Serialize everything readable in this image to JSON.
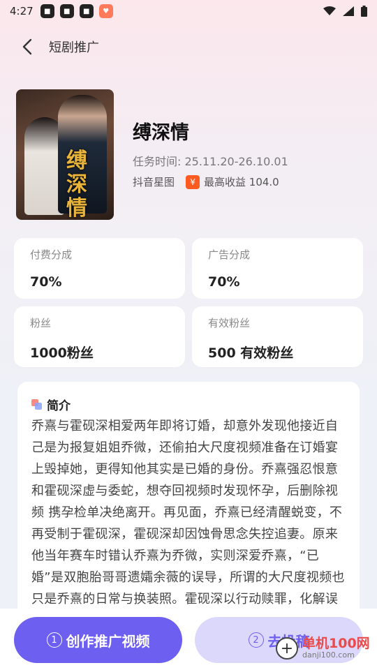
{
  "status_bar": {
    "time": "4:27",
    "app_icons": [
      "app-notification-icon",
      "app-notification-icon",
      "app-notification-icon",
      "app-notification-icon"
    ],
    "system_icons": [
      "wifi-icon",
      "signal-icon",
      "battery-icon"
    ]
  },
  "nav": {
    "title": "短剧推广"
  },
  "drama": {
    "cover_title": "缚深情",
    "title": "缚深情",
    "task_time": "任务时间: 25.11.20-26.10.01",
    "platform": "抖音星图",
    "max_income": "最高收益 104.0",
    "currency_symbol": "¥"
  },
  "stats": [
    {
      "label": "付费分成",
      "value": "70%"
    },
    {
      "label": "广告分成",
      "value": "70%"
    },
    {
      "label": "粉丝",
      "value": "1000粉丝"
    },
    {
      "label": "有效粉丝",
      "value": "500 有效粉丝"
    }
  ],
  "intro": {
    "title": "简介",
    "text": "乔熹与霍砚深相爱两年即将订婚，却意外发现他接近自己是为报复姐姐乔微，还偷拍大尺度视频准备在订婚宴上毁掉她，更得知他其实是已婚的身份。乔熹强忍恨意和霍砚深虚与委蛇，想夺回视频时发现怀孕，后删除视频 携孕检单决绝离开。再见面，乔熹已经清醒蜕变，不再受制于霍砚深，霍砚深却因蚀骨思念失控追妻。原来他当年赛车时错认乔熹为乔微，实则深爱乔熹，“已婚”是双胞胎哥哥遗孀余薇的误导，所谓的大尺度视频也只是乔熹的日常与换装照。霍砚深以行动赎罪，化解误"
  },
  "actions": {
    "create": {
      "num": "1",
      "label": "创作推广视频"
    },
    "submit": {
      "num": "2",
      "label": "去投稿"
    }
  },
  "watermark": {
    "main": "单机100网",
    "sub": "danji100.com"
  },
  "colors": {
    "primary": "#6d5ff0",
    "primary_light": "#dcd8fb",
    "income_badge": "#ff5a1f"
  }
}
